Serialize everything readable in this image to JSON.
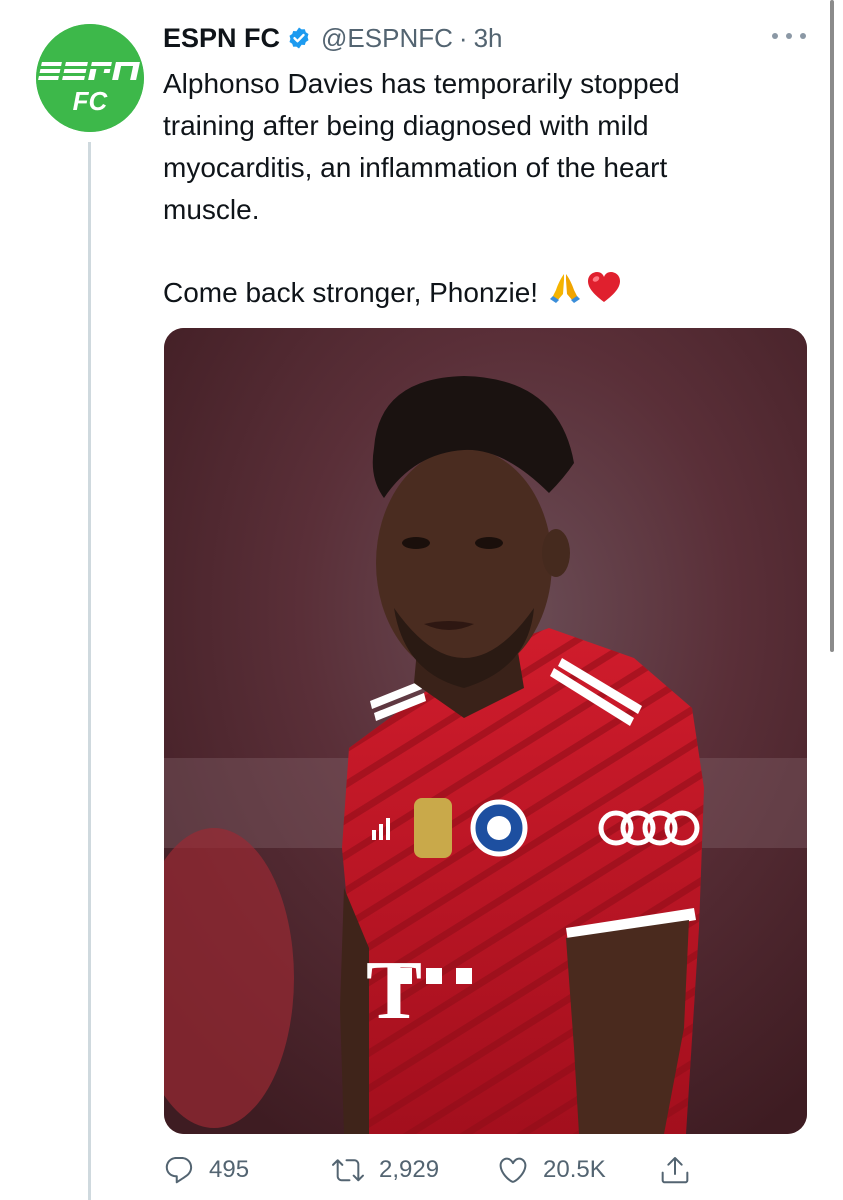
{
  "tweet": {
    "display_name": "ESPN FC",
    "verified": true,
    "handle": "@ESPNFC",
    "separator": "·",
    "time": "3h",
    "text_lines": [
      "Alphonso Davies has temporarily stopped",
      "training after being diagnosed with mild",
      "myocarditis, an inflammation of the heart",
      "muscle."
    ],
    "second_paragraph": "Come back stronger, Phonzie!",
    "emojis": [
      "folded-hands",
      "red-heart"
    ]
  },
  "avatar": {
    "logo_text_top": "ESPN",
    "logo_text_bottom": "FC",
    "background_color": "#3db84a"
  },
  "media": {
    "image_description_icon": "player-photo",
    "jersey_sponsor_text": "T",
    "jersey_color": "#c8102e"
  },
  "actions": {
    "reply_count": "495",
    "retweet_count": "2,929",
    "like_count": "20.5K"
  },
  "colors": {
    "accent": "#1d9bf0",
    "muted": "#536471",
    "text": "#0f1419"
  }
}
